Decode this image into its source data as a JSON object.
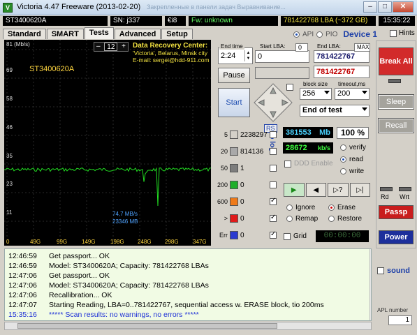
{
  "window": {
    "title": "Victoria 4.47  Freeware (2013-02-20)",
    "ghost_text": "Закрепленные в панели задач    Выравнивание..."
  },
  "status": {
    "model": "ST3400620A",
    "serial": "SN:  j337",
    "firmware_rev": "€i8",
    "fw": "Fw: unknown",
    "lba": "781422768 LBA (~372 GB)",
    "time": "15:35:22"
  },
  "tabs": [
    "Standard",
    "SMART",
    "Tests",
    "Advanced",
    "Setup"
  ],
  "active_tab": "Tests",
  "interface": {
    "api": "API",
    "pio": "PIO",
    "device": "Device 1",
    "hints": "Hints"
  },
  "graph": {
    "y_labels": [
      "81 (Mb/s)",
      "69",
      "58",
      "46",
      "35",
      "23",
      "11"
    ],
    "x_labels": [
      "0",
      "49G",
      "99G",
      "149G",
      "198G",
      "248G",
      "298G",
      "347G"
    ],
    "zoom_minus": "–",
    "zoom_value": "12",
    "zoom_plus": "+",
    "drive_name": "ST3400620A",
    "drc_title": "Data Recovery Center:",
    "drc_line1": "'Victoria', Belarus, Minsk city",
    "drc_line2": "E-mail: sergei@hdd-911.com",
    "speed_value": "74,7 MB/s",
    "speed_pos": "23346 MB",
    "line_color": "#22dd22",
    "text_color": "#ffd640"
  },
  "controls": {
    "end_time_label": "End time",
    "end_time": "2:24",
    "start_lba_label": "Start LBA:",
    "start_lba_zero": "0",
    "start_lba": "0",
    "end_lba_label": "End LBA:",
    "end_lba_max": "MAX",
    "end_lba": "781422767",
    "end_lba_2": "781422767",
    "pause": "Pause",
    "start": "Start",
    "block_size_label": "block size",
    "block_size": "256",
    "timeout_label": "timeout,ms",
    "timeout": "200",
    "end_action": "End of test"
  },
  "counters": [
    {
      "label": "5",
      "value": "2238297",
      "color": "#d4d0c8",
      "checked": false
    },
    {
      "label": "20",
      "value": "814136",
      "color": "#a9a9a9",
      "checked": false
    },
    {
      "label": "50",
      "value": "1",
      "color": "#7d7d7d",
      "checked": false
    },
    {
      "label": "200",
      "value": "0",
      "color": "#1fae2a",
      "checked": false
    },
    {
      "label": "600",
      "value": "0",
      "color": "#ef7a18",
      "checked": true
    },
    {
      "label": ">",
      "value": "0",
      "color": "#e01a1a",
      "checked": true
    },
    {
      "label": "Err",
      "value": "0",
      "color": "#2a3ad0",
      "checked": true
    }
  ],
  "to_log": "to log:",
  "rs": "RS",
  "readouts": {
    "mb": "381553",
    "mb_unit": "Mb",
    "percent": "100",
    "percent_unit": "%",
    "speed": "28672",
    "speed_unit": "kb/s"
  },
  "modes": {
    "verify": "verify",
    "read": "read",
    "write": "write",
    "ddd": "DDD Enable",
    "selected": "read"
  },
  "actions": {
    "ignore": "Ignore",
    "erase": "Erase",
    "remap": "Remap",
    "restore": "Restore",
    "selected": "Erase"
  },
  "grid": {
    "label": "Grid",
    "time": "00:00:00"
  },
  "right": {
    "break_all": "Break All",
    "sleep": "Sleep",
    "recall": "Recall",
    "rd": "Rd",
    "wrt": "Wrt",
    "passp": "Passp",
    "power": "Power",
    "sound": "sound",
    "apl_label": "APL number",
    "apl_value": "1"
  },
  "log": [
    {
      "time": "12:46:59",
      "text": "Get passport... OK",
      "blue": false
    },
    {
      "time": "12:46:59",
      "text": "Model: ST3400620A; Capacity: 781422768 LBAs",
      "blue": false
    },
    {
      "time": "12:47:06",
      "text": "Get passport... OK",
      "blue": false
    },
    {
      "time": "12:47:06",
      "text": "Model: ST3400620A; Capacity: 781422768 LBAs",
      "blue": false
    },
    {
      "time": "12:47:06",
      "text": "Recallibration... OK",
      "blue": false
    },
    {
      "time": "12:47:07",
      "text": "Starting Reading, LBA=0..781422767, sequential access w. ERASE block, tio 200ms",
      "blue": false
    },
    {
      "time": "15:35:16",
      "text": "***** Scan results: no warnings, no errors *****",
      "blue": true
    }
  ]
}
